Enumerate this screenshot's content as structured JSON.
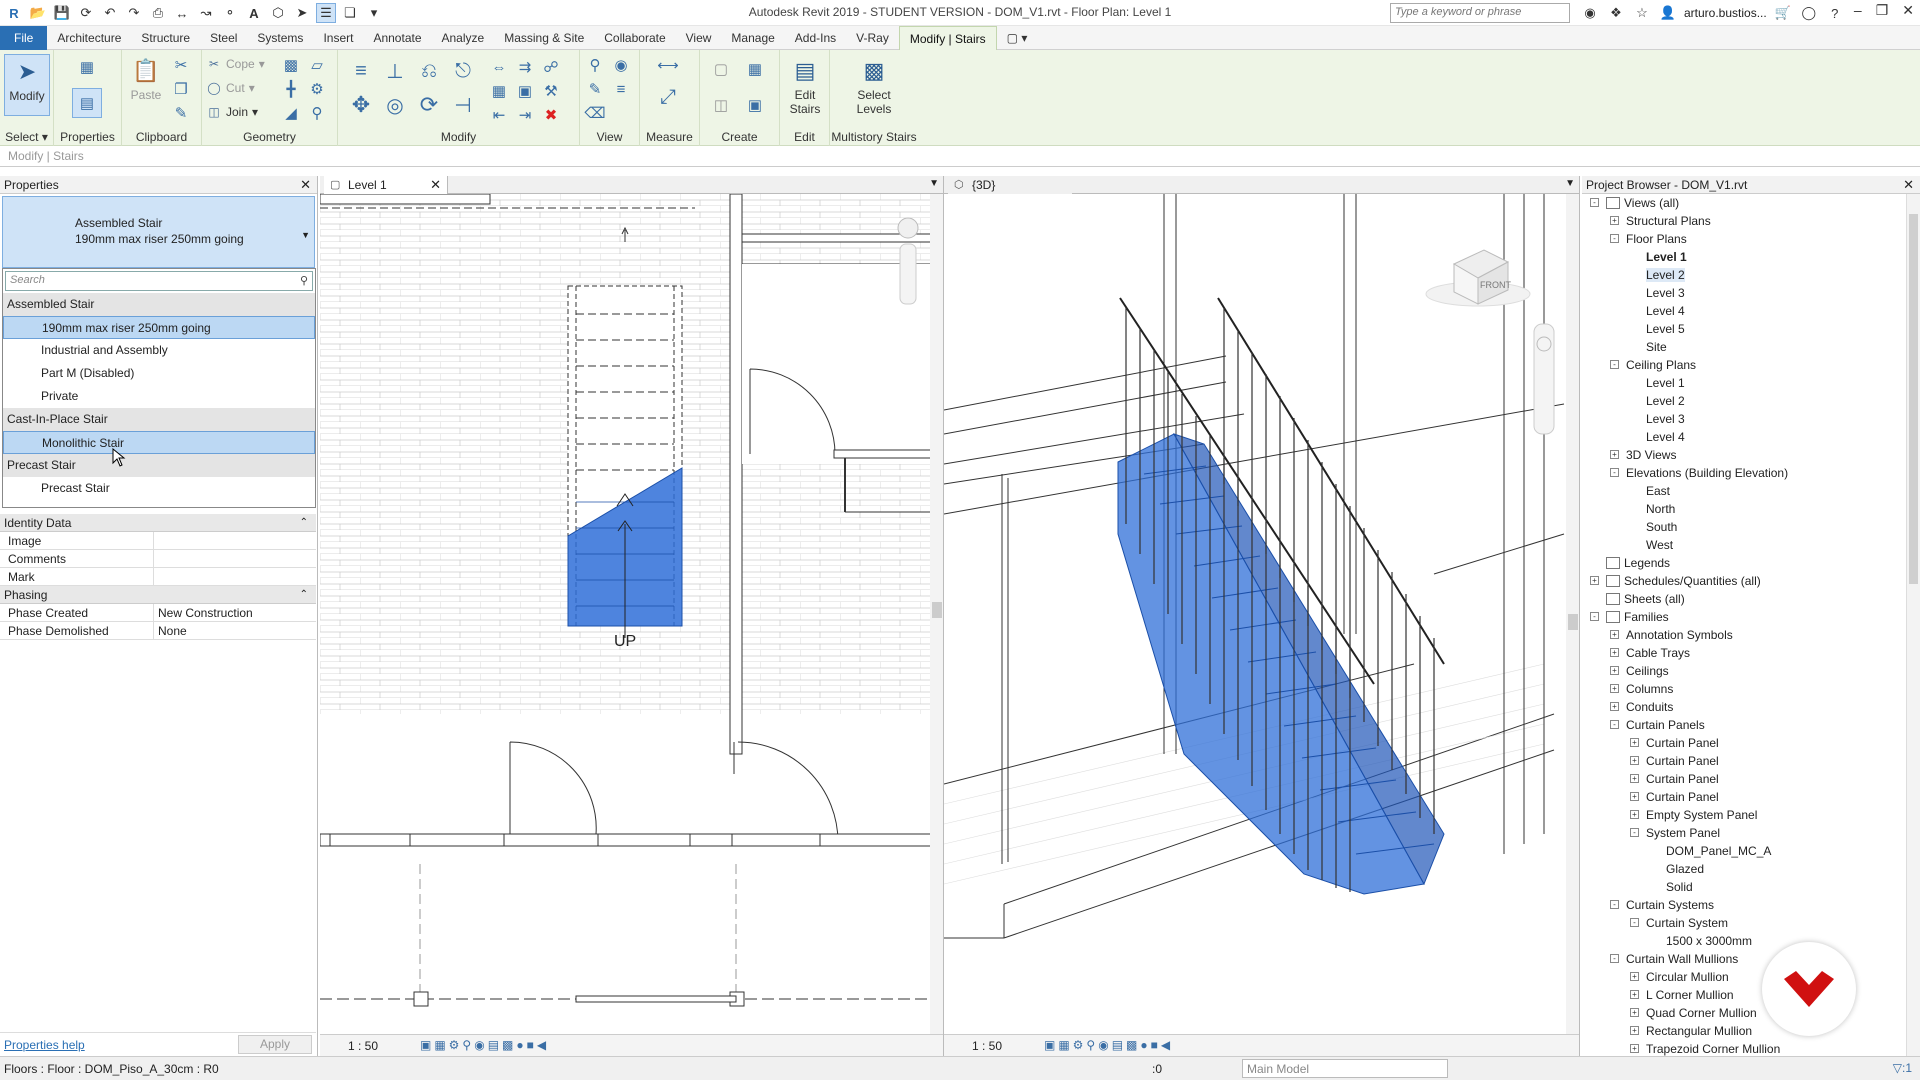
{
  "app": {
    "title": "Autodesk Revit 2019 - STUDENT VERSION - DOM_V1.rvt - Floor Plan: Level 1",
    "search_placeholder": "Type a keyword or phrase",
    "user": "arturo.bustios..."
  },
  "tabs": [
    "File",
    "Architecture",
    "Structure",
    "Steel",
    "Systems",
    "Insert",
    "Annotate",
    "Analyze",
    "Massing & Site",
    "Collaborate",
    "View",
    "Manage",
    "Add-Ins",
    "V-Ray",
    "Modify | Stairs"
  ],
  "ribbon": {
    "select": {
      "label": "Select",
      "modify": "Modify"
    },
    "properties": {
      "label": "Properties"
    },
    "clipboard": {
      "label": "Clipboard",
      "paste": "Paste"
    },
    "geometry": {
      "label": "Geometry",
      "cope": "Cope",
      "cut": "Cut",
      "join": "Join"
    },
    "modify": {
      "label": "Modify"
    },
    "view": {
      "label": "View"
    },
    "measure": {
      "label": "Measure"
    },
    "create": {
      "label": "Create"
    },
    "edit": {
      "label": "Edit",
      "edit_stairs": "Edit Stairs"
    },
    "multistory": {
      "label": "Multistory Stairs",
      "select_levels": "Select Levels"
    }
  },
  "context_bar": "Modify | Stairs",
  "properties": {
    "title": "Properties",
    "type_family": "Assembled Stair",
    "type_name": "190mm max riser 250mm going",
    "search_placeholder": "Search",
    "groups": [
      {
        "name": "Assembled Stair",
        "items": [
          "190mm max riser 250mm going",
          "Industrial and Assembly",
          "Part M (Disabled)",
          "Private"
        ]
      },
      {
        "name": "Cast-In-Place Stair",
        "items": [
          "Monolithic Stair"
        ]
      },
      {
        "name": "Precast Stair",
        "items": [
          "Precast Stair"
        ]
      }
    ],
    "sections": {
      "identity": "Identity Data",
      "phasing": "Phasing"
    },
    "identity_rows": [
      {
        "k": "Image",
        "v": ""
      },
      {
        "k": "Comments",
        "v": ""
      },
      {
        "k": "Mark",
        "v": ""
      }
    ],
    "phasing_rows": [
      {
        "k": "Phase Created",
        "v": "New Construction"
      },
      {
        "k": "Phase Demolished",
        "v": "None"
      }
    ],
    "help": "Properties help",
    "apply": "Apply"
  },
  "views": {
    "plan": {
      "tab": "Level 1",
      "scale": "1 : 50",
      "up_label": "UP"
    },
    "threed": {
      "tab": "{3D}",
      "scale": "1 : 50",
      "cube_label": "FRONT"
    }
  },
  "browser": {
    "title": "Project Browser - DOM_V1.rvt",
    "nodes": [
      {
        "t": "Views (all)",
        "l": 0,
        "tog": "-",
        "icon": true
      },
      {
        "t": "Structural Plans",
        "l": 1,
        "tog": "+"
      },
      {
        "t": "Floor Plans",
        "l": 1,
        "tog": "-"
      },
      {
        "t": "Level 1",
        "l": 2,
        "bold": true
      },
      {
        "t": "Level 2",
        "l": 2,
        "hl": true
      },
      {
        "t": "Level 3",
        "l": 2
      },
      {
        "t": "Level 4",
        "l": 2
      },
      {
        "t": "Level 5",
        "l": 2
      },
      {
        "t": "Site",
        "l": 2
      },
      {
        "t": "Ceiling Plans",
        "l": 1,
        "tog": "-"
      },
      {
        "t": "Level 1",
        "l": 2
      },
      {
        "t": "Level 2",
        "l": 2
      },
      {
        "t": "Level 3",
        "l": 2
      },
      {
        "t": "Level 4",
        "l": 2
      },
      {
        "t": "3D Views",
        "l": 1,
        "tog": "+"
      },
      {
        "t": "Elevations (Building Elevation)",
        "l": 1,
        "tog": "-"
      },
      {
        "t": "East",
        "l": 2
      },
      {
        "t": "North",
        "l": 2
      },
      {
        "t": "South",
        "l": 2
      },
      {
        "t": "West",
        "l": 2
      },
      {
        "t": "Legends",
        "l": 0,
        "icon": true
      },
      {
        "t": "Schedules/Quantities (all)",
        "l": 0,
        "tog": "+",
        "icon": true
      },
      {
        "t": "Sheets (all)",
        "l": 0,
        "icon": true
      },
      {
        "t": "Families",
        "l": 0,
        "tog": "-",
        "icon": true
      },
      {
        "t": "Annotation Symbols",
        "l": 1,
        "tog": "+"
      },
      {
        "t": "Cable Trays",
        "l": 1,
        "tog": "+"
      },
      {
        "t": "Ceilings",
        "l": 1,
        "tog": "+"
      },
      {
        "t": "Columns",
        "l": 1,
        "tog": "+"
      },
      {
        "t": "Conduits",
        "l": 1,
        "tog": "+"
      },
      {
        "t": "Curtain Panels",
        "l": 1,
        "tog": "-"
      },
      {
        "t": "Curtain Panel",
        "l": 2,
        "tog": "+"
      },
      {
        "t": "Curtain Panel",
        "l": 2,
        "tog": "+"
      },
      {
        "t": "Curtain Panel",
        "l": 2,
        "tog": "+"
      },
      {
        "t": "Curtain Panel",
        "l": 2,
        "tog": "+"
      },
      {
        "t": "Empty System Panel",
        "l": 2,
        "tog": "+"
      },
      {
        "t": "System Panel",
        "l": 2,
        "tog": "-"
      },
      {
        "t": "DOM_Panel_MC_A",
        "l": 3
      },
      {
        "t": "Glazed",
        "l": 3
      },
      {
        "t": "Solid",
        "l": 3
      },
      {
        "t": "Curtain Systems",
        "l": 1,
        "tog": "-"
      },
      {
        "t": "Curtain System",
        "l": 2,
        "tog": "-"
      },
      {
        "t": "1500 x 3000mm",
        "l": 3
      },
      {
        "t": "Curtain Wall Mullions",
        "l": 1,
        "tog": "-"
      },
      {
        "t": "Circular Mullion",
        "l": 2,
        "tog": "+"
      },
      {
        "t": "L Corner Mullion",
        "l": 2,
        "tog": "+"
      },
      {
        "t": "Quad Corner Mullion",
        "l": 2,
        "tog": "+"
      },
      {
        "t": "Rectangular Mullion",
        "l": 2,
        "tog": "+"
      },
      {
        "t": "Trapezoid Corner Mullion",
        "l": 2,
        "tog": "+"
      }
    ]
  },
  "status": {
    "message": "Floors : Floor : DOM_Piso_A_30cm : R0",
    "selected": ":0",
    "model": "Main Model",
    "filter": ":1"
  },
  "colors": {
    "accent": "#2a6fb4",
    "stair_blue": "#2f6fd8",
    "ribbon_bg": "#eef5e6"
  }
}
